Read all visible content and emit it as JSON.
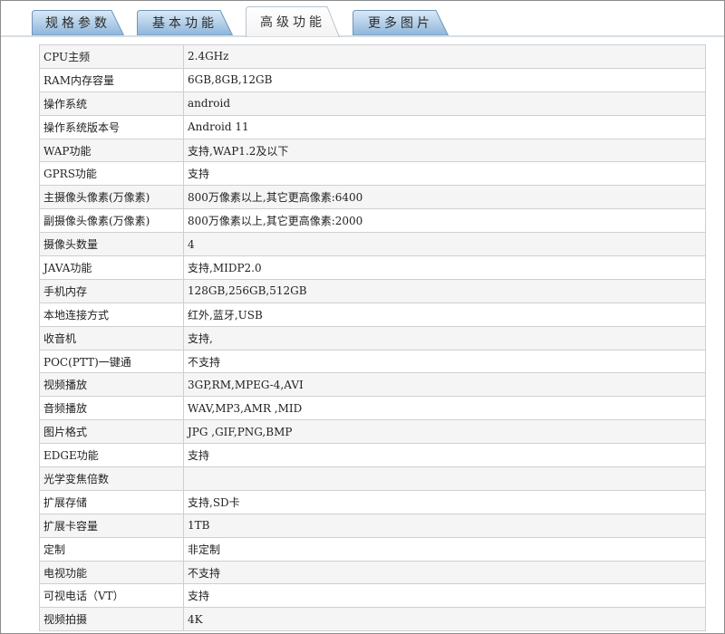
{
  "tabs": [
    {
      "label": "规格参数",
      "active": false
    },
    {
      "label": "基本功能",
      "active": false
    },
    {
      "label": "高级功能",
      "active": true
    },
    {
      "label": "更多图片",
      "active": false
    }
  ],
  "colors": {
    "tab_blue_top": "#d9e9f6",
    "tab_blue_bottom": "#8fb7db",
    "tab_border": "#6e97bd",
    "row_alt": "#f5f5f5",
    "cell_border": "#cfcfcf"
  },
  "rows": [
    {
      "key": "CPU主频",
      "value": "2.4GHz"
    },
    {
      "key": "RAM内存容量",
      "value": "6GB,8GB,12GB"
    },
    {
      "key": "操作系统",
      "value": "android"
    },
    {
      "key": "操作系统版本号",
      "value": "Android 11"
    },
    {
      "key": "WAP功能",
      "value": "支持,WAP1.2及以下"
    },
    {
      "key": "GPRS功能",
      "value": "支持"
    },
    {
      "key": "主摄像头像素(万像素)",
      "value": "800万像素以上,其它更高像素:6400"
    },
    {
      "key": "副摄像头像素(万像素)",
      "value": "800万像素以上,其它更高像素:2000"
    },
    {
      "key": "摄像头数量",
      "value": "4"
    },
    {
      "key": "JAVA功能",
      "value": "支持,MIDP2.0"
    },
    {
      "key": "手机内存",
      "value": "128GB,256GB,512GB"
    },
    {
      "key": "本地连接方式",
      "value": "红外,蓝牙,USB"
    },
    {
      "key": "收音机",
      "value": "支持,"
    },
    {
      "key": "POC(PTT)一键通",
      "value": "不支持"
    },
    {
      "key": "视频播放",
      "value": "3GP,RM,MPEG-4,AVI"
    },
    {
      "key": "音频播放",
      "value": "WAV,MP3,AMR ,MID"
    },
    {
      "key": "图片格式",
      "value": "JPG ,GIF,PNG,BMP"
    },
    {
      "key": "EDGE功能",
      "value": "支持"
    },
    {
      "key": "光学变焦倍数",
      "value": ""
    },
    {
      "key": "扩展存储",
      "value": "支持,SD卡"
    },
    {
      "key": "扩展卡容量",
      "value": "1TB"
    },
    {
      "key": "定制",
      "value": "非定制"
    },
    {
      "key": "电视功能",
      "value": "不支持"
    },
    {
      "key": "可视电话（VT）",
      "value": "支持"
    },
    {
      "key": "视频拍摄",
      "value": "4K"
    }
  ]
}
